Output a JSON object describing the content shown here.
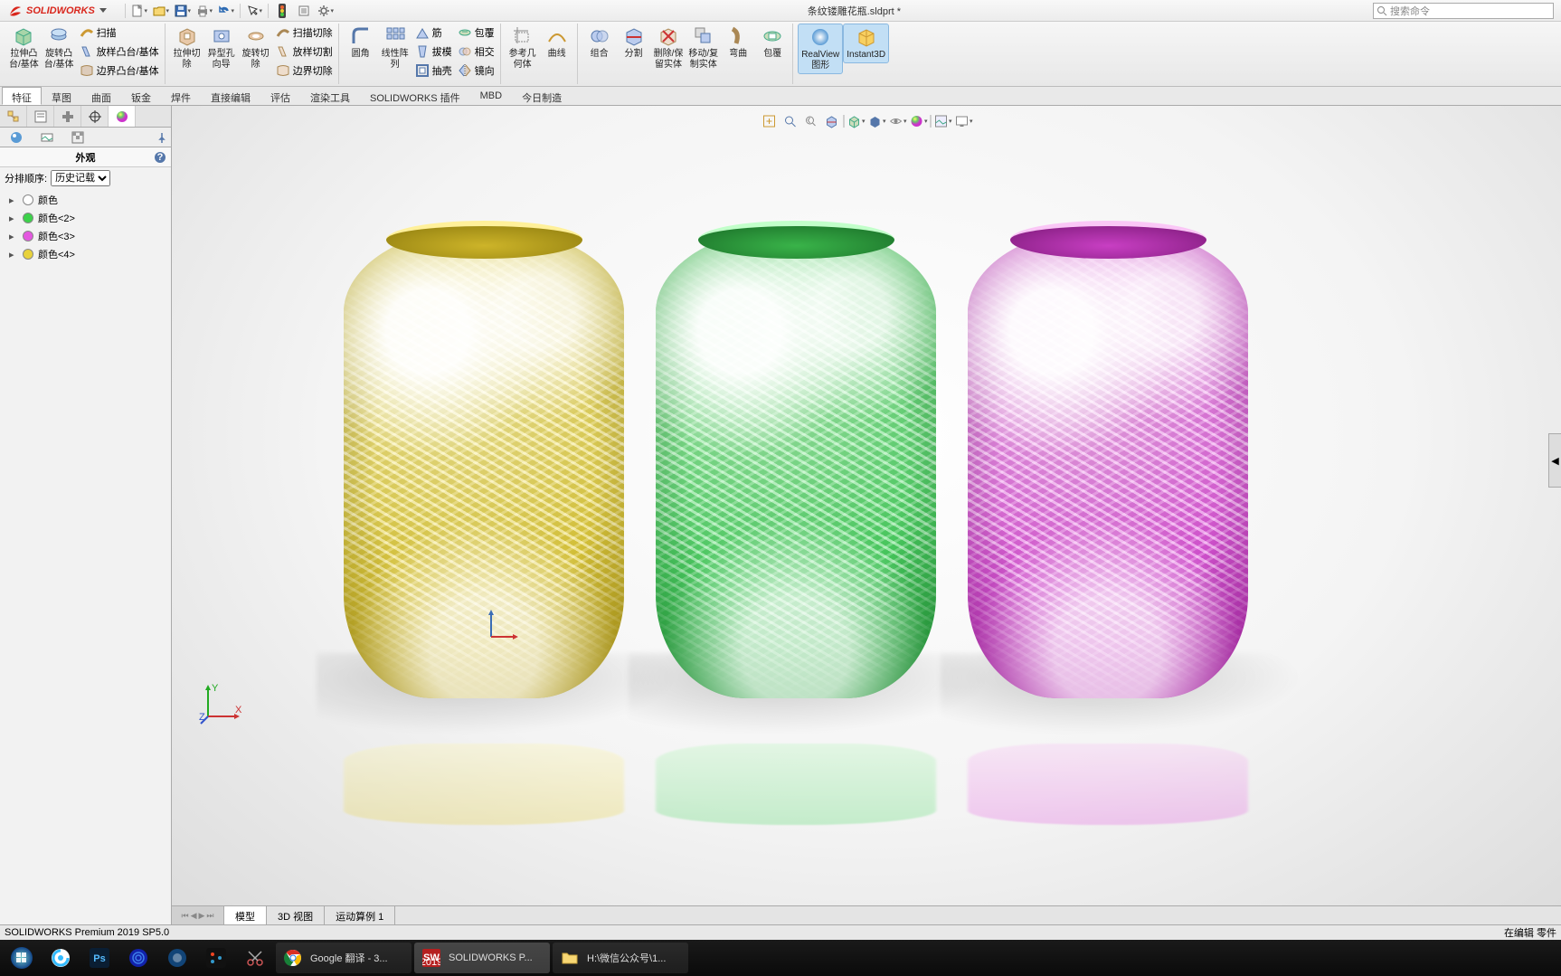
{
  "app": {
    "logo_text": "SOLIDWORKS",
    "doc_title": "条纹镂雕花瓶.sldprt *",
    "search_placeholder": "搜索命令"
  },
  "ribbon": {
    "extrude": "拉伸凸\n台/基体",
    "revolve": "旋转凸\n台/基体",
    "sweep": "扫描",
    "loft": "放样凸台/基体",
    "boundary": "边界凸台/基体",
    "extrude_cut": "拉伸切\n除",
    "hole_wizard": "异型孔\n向导",
    "revolve_cut": "旋转切\n除",
    "swept_cut": "扫描切除",
    "lofted_cut": "放样切割",
    "boundary_cut": "边界切除",
    "fillet": "圆角",
    "linear_pattern": "线性阵\n列",
    "rib": "筋",
    "draft": "拔模",
    "shell": "抽壳",
    "wrap": "包覆",
    "intersect": "相交",
    "mirror": "镜向",
    "ref_geo": "参考几\n何体",
    "curve": "曲线",
    "combine": "组合",
    "split": "分割",
    "delete_keep": "删除/保\n留实体",
    "move_copy": "移动/复\n制实体",
    "bend": "弯曲",
    "wrap2": "包覆",
    "realview": "RealView\n图形",
    "instant3d": "Instant3D"
  },
  "cmd_tabs": [
    "特征",
    "草图",
    "曲面",
    "钣金",
    "焊件",
    "直接编辑",
    "评估",
    "渲染工具",
    "SOLIDWORKS 插件",
    "MBD",
    "今日制造"
  ],
  "sidebar": {
    "title": "外观",
    "sort_label": "分排顺序:",
    "sort_value": "历史记载",
    "items": [
      {
        "label": "颜色",
        "color": "#ffffff"
      },
      {
        "label": "颜色<2>",
        "color": "#3cd24a"
      },
      {
        "label": "颜色<3>",
        "color": "#e458e0"
      },
      {
        "label": "颜色<4>",
        "color": "#e8d23c"
      }
    ]
  },
  "vp_tabs": [
    "模型",
    "3D 视图",
    "运动算例 1"
  ],
  "status": {
    "left": "SOLIDWORKS Premium 2019 SP5.0",
    "right": "在编辑 零件"
  },
  "taskbar": {
    "items": [
      {
        "label": "Google 翻译 - 3..."
      },
      {
        "label": "SOLIDWORKS P..."
      },
      {
        "label": "H:\\微信公众号\\1..."
      }
    ]
  }
}
